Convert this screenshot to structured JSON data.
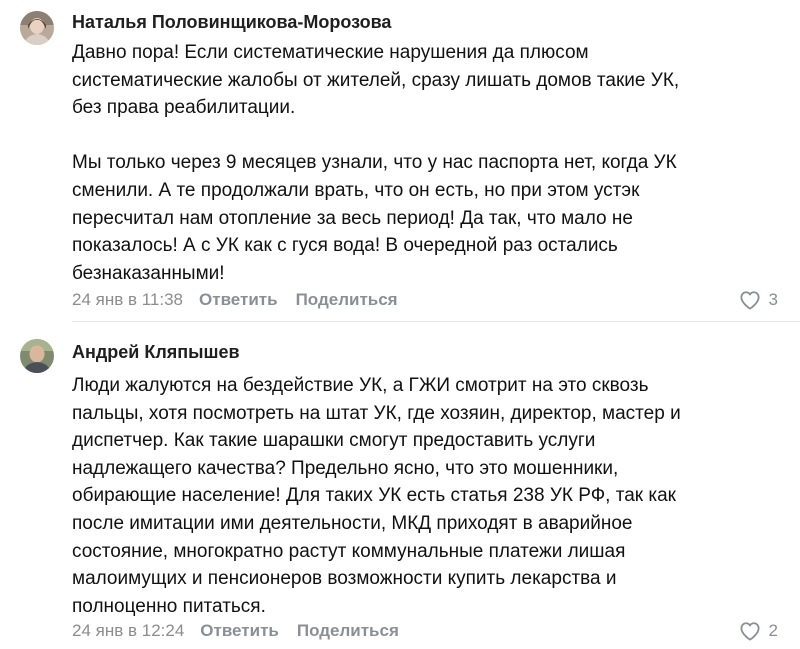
{
  "comments": [
    {
      "author": "Наталья Половинщикова-Морозова",
      "paragraphs": [
        "Давно пора! Если систематические нарушения да плюсом\nсистематические жалобы от жителей, сразу лишать домов такие УК,\nбез права реабилитации.",
        "Мы только через 9 месяцев узнали, что у нас паспорта нет, когда УК\nсменили. А те продолжали врать, что он есть, но при этом устэк\nпересчитал нам отопление за весь период! Да так, что мало не\nпоказалось! А с УК как с гуся вода! В очередной раз остались\nбезнаказанными!"
      ],
      "date": "24 янв в 11:38",
      "reply_label": "Ответить",
      "share_label": "Поделиться",
      "likes": "3",
      "avatar_icon": "user-avatar-photo"
    },
    {
      "author": "Андрей Кляпышев",
      "paragraphs": [
        "Люди жалуются на бездействие УК, а ГЖИ смотрит на это сквозь\nпальцы, хотя посмотреть на штат УК, где хозяин, директор, мастер и\nдиспетчер. Как такие шарашки смогут предоставить услуги\nнадлежащего качества? Предельно ясно, что это мошенники,\nобирающие население! Для таких УК есть статья 238 УК РФ, так как\nпосле имитации ими деятельности, МКД приходят в аварийное\nсостояние, многократно растут коммунальные платежи лишая\nмалоимущих и пенсионеров возможности купить лекарства и\nполноценно питаться."
      ],
      "date": "24 янв в 12:24",
      "reply_label": "Ответить",
      "share_label": "Поделиться",
      "likes": "2",
      "avatar_icon": "user-avatar-photo"
    }
  ],
  "colors": {
    "meta_text": "#8c8c8c",
    "action_text": "#8a8f96",
    "divider": "#e7e8ec"
  }
}
